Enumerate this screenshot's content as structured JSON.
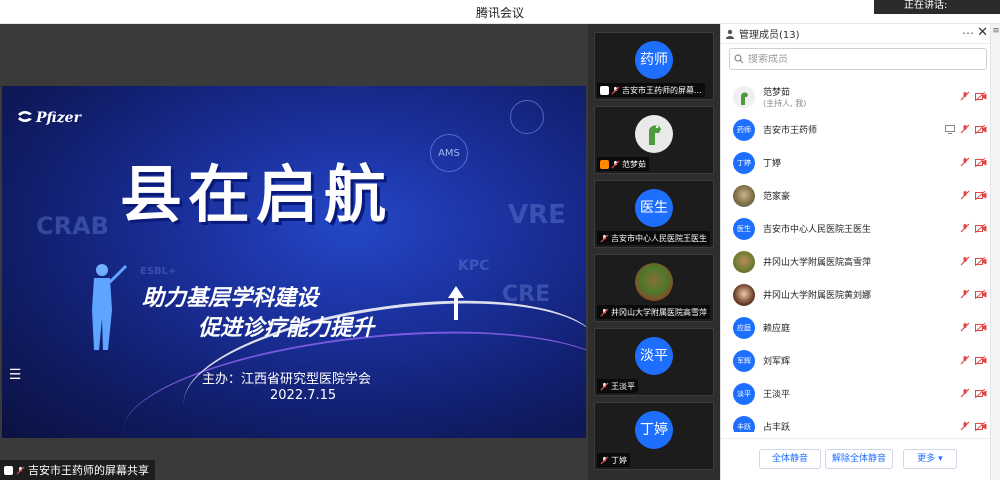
{
  "window": {
    "title": "腾讯会议",
    "toast_text": "正在讲话:"
  },
  "slide": {
    "brand": "Pfizer",
    "title": "县在启航",
    "subtitle_line1": "助力基层学科建设",
    "subtitle_line2": "促进诊疗能力提升",
    "host": "主办：江西省研究型医院学会",
    "date": "2022.7.15",
    "bg_words": [
      "CRAB",
      "VRE",
      "KPC",
      "CRE",
      "ESBL+",
      "AMS"
    ]
  },
  "share_label": "吉安市王药师的屏幕共享",
  "gallery": [
    {
      "avatar": "药师",
      "name": "吉安市王药师的屏幕..."
    },
    {
      "avatar": "",
      "name": "范梦茹"
    },
    {
      "avatar": "医生",
      "name": "吉安市中心人民医院王医生"
    },
    {
      "avatar": "",
      "name": "井冈山大学附属医院高雪萍"
    },
    {
      "avatar": "淡平",
      "name": "王淡平"
    },
    {
      "avatar": "丁婷",
      "name": "丁婷"
    }
  ],
  "panel": {
    "title": "管理成员(13)",
    "search_placeholder": "搜索成员",
    "members": [
      {
        "name": "范梦茹",
        "role": "(主持人, 我)",
        "avatar": ""
      },
      {
        "name": "吉安市王药师",
        "avatar": "药师"
      },
      {
        "name": "丁婷",
        "avatar": "丁婷"
      },
      {
        "name": "范家豪",
        "avatar": ""
      },
      {
        "name": "吉安市中心人民医院王医生",
        "avatar": "医生"
      },
      {
        "name": "井冈山大学附属医院高雪萍",
        "avatar": ""
      },
      {
        "name": "井冈山大学附属医院黄刘娜",
        "avatar": ""
      },
      {
        "name": "赖应庭",
        "avatar": "应庭"
      },
      {
        "name": "刘军辉",
        "avatar": "军辉"
      },
      {
        "name": "王淡平",
        "avatar": "淡平"
      },
      {
        "name": "占丰跃",
        "avatar": "丰跃"
      }
    ],
    "buttons": {
      "mute_all": "全体静音",
      "unmute_all": "解除全体静音",
      "more": "更多 ▾"
    }
  },
  "colors": {
    "accent": "#1f6fff",
    "muted_red": "#e04848"
  }
}
